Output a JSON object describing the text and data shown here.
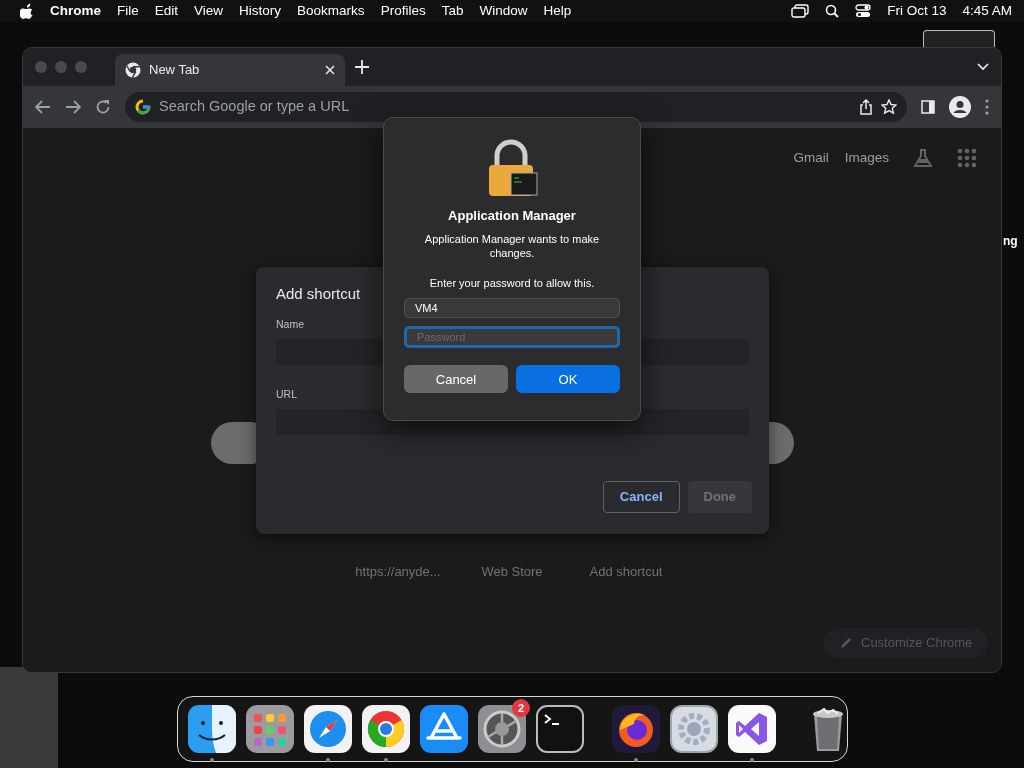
{
  "menu_bar": {
    "app": "Chrome",
    "items": [
      "File",
      "Edit",
      "View",
      "History",
      "Bookmarks",
      "Profiles",
      "Tab",
      "Window",
      "Help"
    ],
    "date": "Fri Oct 13",
    "time": "4:45 AM"
  },
  "browser": {
    "tabs": [
      {
        "title": "New Tab",
        "selected": true
      }
    ],
    "omnibox": {
      "placeholder": "Search Google or type a URL"
    },
    "header_links": [
      "Gmail",
      "Images"
    ],
    "shortcuts": [
      {
        "label": "https://anyde..."
      },
      {
        "label": "Web Store"
      },
      {
        "label": "Add shortcut"
      }
    ],
    "customize_button": "Customize Chrome",
    "add_shortcut_dialog": {
      "title": "Add shortcut",
      "fields": [
        {
          "label": "Name"
        },
        {
          "label": "URL"
        }
      ],
      "buttons": [
        {
          "label": "Cancel",
          "kind": "outline",
          "disabled": false
        },
        {
          "label": "Done",
          "kind": "primary",
          "disabled": true
        }
      ]
    }
  },
  "auth_dialog": {
    "title": "Application Manager",
    "message": "Application Manager wants to make changes.",
    "prompt": "Enter your password to allow this.",
    "username": "VM4",
    "password": {
      "placeholder": "Password",
      "focused": true
    },
    "buttons": [
      {
        "label": "Cancel",
        "kind": "secondary"
      },
      {
        "label": "OK",
        "kind": "default"
      }
    ]
  },
  "background_text": "ng",
  "dock": [
    {
      "kind": "app",
      "running": true
    },
    {
      "kind": "app",
      "running": false
    },
    {
      "kind": "app",
      "running": true
    },
    {
      "kind": "app",
      "running": true
    },
    {
      "kind": "app",
      "running": false
    },
    {
      "kind": "app",
      "running": false,
      "badge": "2"
    },
    {
      "kind": "app",
      "running": false
    },
    {
      "kind": "separator"
    },
    {
      "kind": "app",
      "running": true
    },
    {
      "kind": "app",
      "running": false
    },
    {
      "kind": "app",
      "running": true
    },
    {
      "kind": "separator"
    },
    {
      "kind": "app",
      "running": false
    }
  ]
}
